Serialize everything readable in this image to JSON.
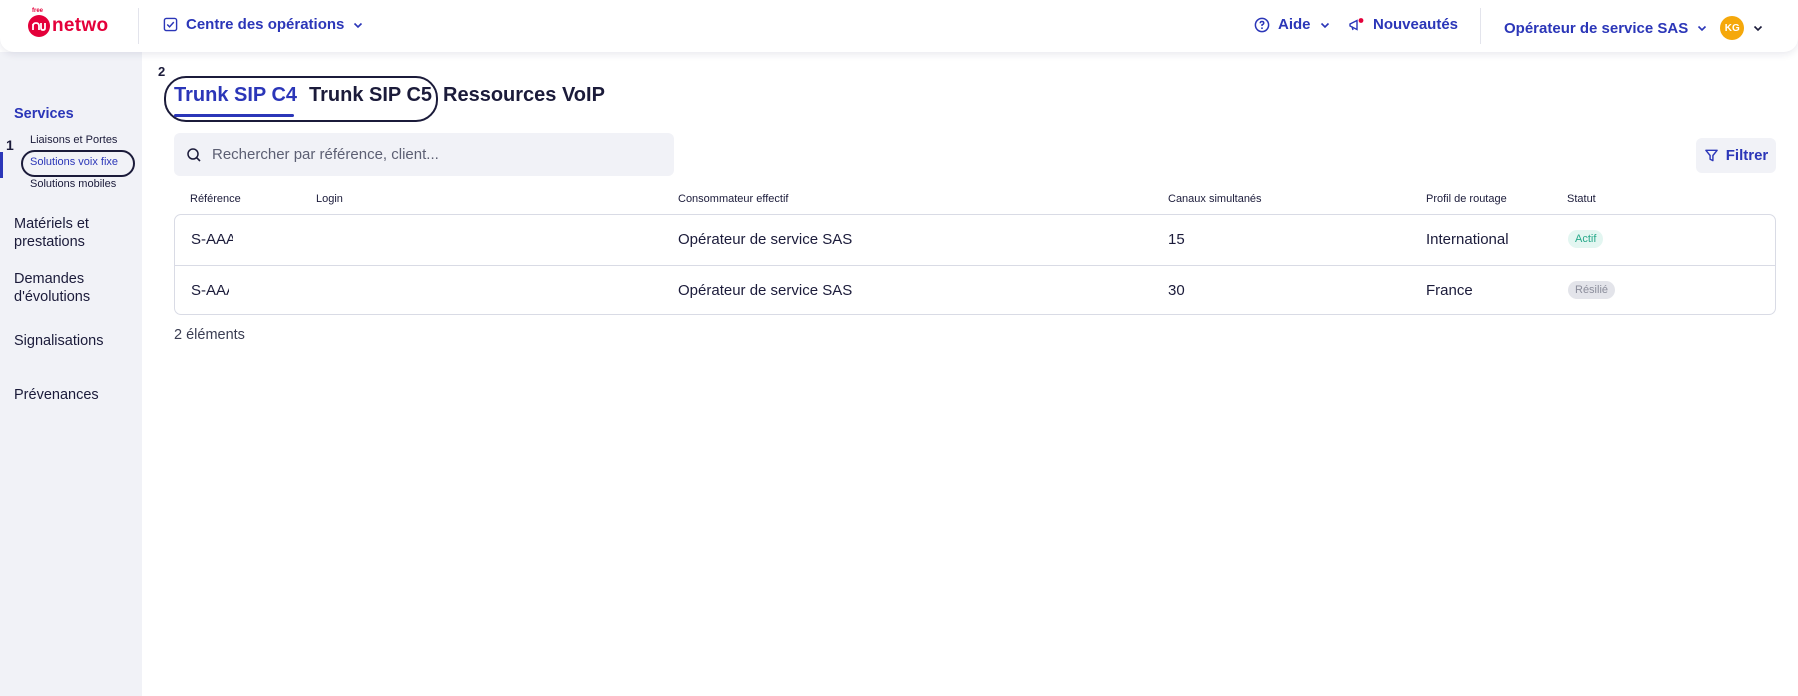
{
  "header": {
    "logo_small": "free",
    "logo_text": "netwo",
    "workspace_label": "Centre des opérations",
    "help_label": "Aide",
    "news_label": "Nouveautés",
    "company_label": "Opérateur de service SAS",
    "avatar_initials": "KG"
  },
  "sidebar": {
    "annotation_step": "1",
    "items": [
      {
        "label": "Services",
        "active": true
      },
      {
        "label": "Matériels et prestations"
      },
      {
        "label": "Demandes d'évolutions"
      },
      {
        "label": "Signalisations"
      },
      {
        "label": "Prévenances"
      }
    ],
    "sub_items": [
      {
        "label": "Liaisons et Portes"
      },
      {
        "label": "Solutions voix fixe",
        "active": true
      },
      {
        "label": "Solutions mobiles"
      }
    ]
  },
  "main": {
    "annotation_step": "2",
    "tabs": [
      {
        "label": "Trunk SIP C4",
        "active": true
      },
      {
        "label": "Trunk SIP C5"
      },
      {
        "label": "Ressources VoIP"
      }
    ],
    "search_placeholder": "Rechercher par référence, client...",
    "filter_label": "Filtrer",
    "table": {
      "columns": [
        "Référence",
        "Login",
        "Consommateur effectif",
        "Canaux simultanés",
        "Profil de routage",
        "Statut"
      ],
      "rows": [
        {
          "reference": "S-AAA",
          "login": "",
          "consumer": "Opérateur de service SAS",
          "channels": "15",
          "routing": "International",
          "status": "Actif"
        },
        {
          "reference": "S-AAA",
          "login": "",
          "consumer": "Opérateur de service SAS",
          "channels": "30",
          "routing": "France",
          "status": "Résilié"
        }
      ]
    },
    "items_count": "2 éléments"
  },
  "colors": {
    "brand": "#e4003a",
    "accent": "#2b36b8",
    "status_active": "#27a98a",
    "status_terminated": "#8b8d9b",
    "avatar": "#f5a80b"
  }
}
